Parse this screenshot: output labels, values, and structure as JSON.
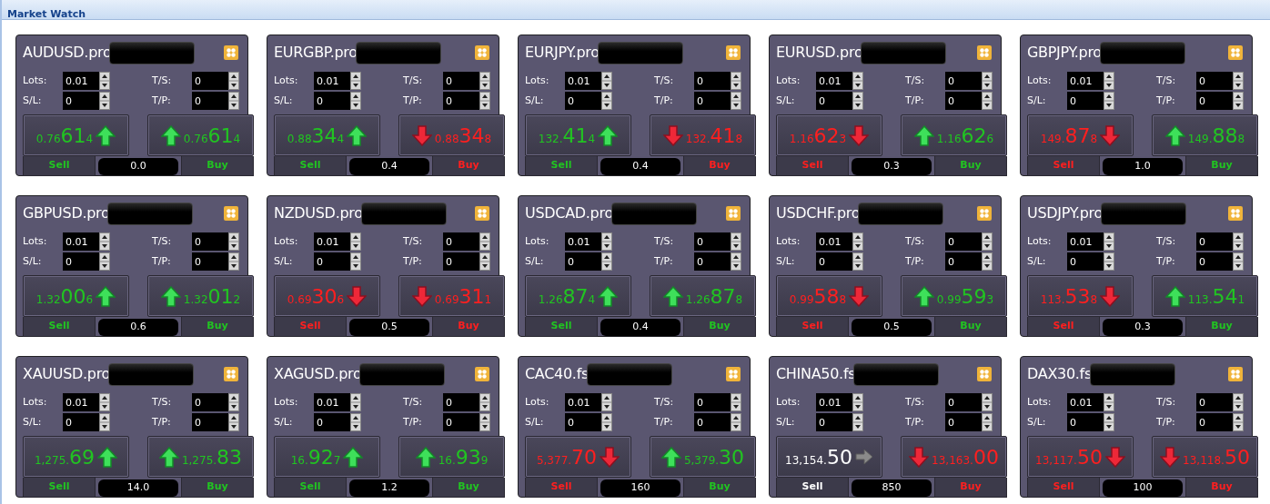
{
  "panel_title": "Market Watch",
  "cards": [
    {
      "symbol": "AUDUSD.pro",
      "labels": [
        "Lots:",
        "T/S:",
        "S/L:",
        "T/P:"
      ],
      "lots": "0.01",
      "sl": "0",
      "ts": "0",
      "tp": "0",
      "sell": {
        "prefix": "0.76",
        "big": "61",
        "pip": "4",
        "kind": "up",
        "label": "Sell"
      },
      "buy": {
        "prefix": "0.76",
        "big": "61",
        "pip": "4",
        "kind": "up",
        "label": "Buy"
      },
      "spread": "0.0"
    },
    {
      "symbol": "EURGBP.pro",
      "labels": [
        "Lots:",
        "T/S:",
        "S/L:",
        "T/P:"
      ],
      "lots": "0.01",
      "sl": "0",
      "ts": "0",
      "tp": "0",
      "sell": {
        "prefix": "0.88",
        "big": "34",
        "pip": "4",
        "kind": "up",
        "label": "Sell"
      },
      "buy": {
        "prefix": "0.88",
        "big": "34",
        "pip": "8",
        "kind": "down",
        "label": "Buy"
      },
      "spread": "0.4"
    },
    {
      "symbol": "EURJPY.pro",
      "labels": [
        "Lots:",
        "T/S:",
        "S/L:",
        "T/P:"
      ],
      "lots": "0.01",
      "sl": "0",
      "ts": "0",
      "tp": "0",
      "sell": {
        "prefix": "132.",
        "big": "41",
        "pip": "4",
        "kind": "up",
        "label": "Sell"
      },
      "buy": {
        "prefix": "132.",
        "big": "41",
        "pip": "8",
        "kind": "down",
        "label": "Buy"
      },
      "spread": "0.4"
    },
    {
      "symbol": "EURUSD.pro",
      "labels": [
        "Lots:",
        "T/S:",
        "S/L:",
        "T/P:"
      ],
      "lots": "0.01",
      "sl": "0",
      "ts": "0",
      "tp": "0",
      "sell": {
        "prefix": "1.16",
        "big": "62",
        "pip": "3",
        "kind": "down",
        "label": "Sell"
      },
      "buy": {
        "prefix": "1.16",
        "big": "62",
        "pip": "6",
        "kind": "up",
        "label": "Buy"
      },
      "spread": "0.3"
    },
    {
      "symbol": "GBPJPY.pro",
      "labels": [
        "Lots:",
        "T/S:",
        "S/L:",
        "T/P:"
      ],
      "lots": "0.01",
      "sl": "0",
      "ts": "0",
      "tp": "0",
      "sell": {
        "prefix": "149.",
        "big": "87",
        "pip": "8",
        "kind": "down",
        "label": "Sell"
      },
      "buy": {
        "prefix": "149.",
        "big": "88",
        "pip": "8",
        "kind": "up",
        "label": "Buy"
      },
      "spread": "1.0"
    },
    {
      "symbol": "GBPUSD.pro",
      "labels": [
        "Lots:",
        "T/S:",
        "S/L:",
        "T/P:"
      ],
      "lots": "0.01",
      "sl": "0",
      "ts": "0",
      "tp": "0",
      "sell": {
        "prefix": "1.32",
        "big": "00",
        "pip": "6",
        "kind": "up",
        "label": "Sell"
      },
      "buy": {
        "prefix": "1.32",
        "big": "01",
        "pip": "2",
        "kind": "up",
        "label": "Buy"
      },
      "spread": "0.6"
    },
    {
      "symbol": "NZDUSD.pro",
      "labels": [
        "Lots:",
        "T/S:",
        "S/L:",
        "T/P:"
      ],
      "lots": "0.01",
      "sl": "0",
      "ts": "0",
      "tp": "0",
      "sell": {
        "prefix": "0.69",
        "big": "30",
        "pip": "6",
        "kind": "down",
        "label": "Sell"
      },
      "buy": {
        "prefix": "0.69",
        "big": "31",
        "pip": "1",
        "kind": "down",
        "label": "Buy"
      },
      "spread": "0.5"
    },
    {
      "symbol": "USDCAD.pro",
      "labels": [
        "Lots:",
        "T/S:",
        "S/L:",
        "T/P:"
      ],
      "lots": "0.01",
      "sl": "0",
      "ts": "0",
      "tp": "0",
      "sell": {
        "prefix": "1.26",
        "big": "87",
        "pip": "4",
        "kind": "up",
        "label": "Sell"
      },
      "buy": {
        "prefix": "1.26",
        "big": "87",
        "pip": "8",
        "kind": "up",
        "label": "Buy"
      },
      "spread": "0.4"
    },
    {
      "symbol": "USDCHF.pro",
      "labels": [
        "Lots:",
        "T/S:",
        "S/L:",
        "T/P:"
      ],
      "lots": "0.01",
      "sl": "0",
      "ts": "0",
      "tp": "0",
      "sell": {
        "prefix": "0.99",
        "big": "58",
        "pip": "8",
        "kind": "down",
        "label": "Sell"
      },
      "buy": {
        "prefix": "0.99",
        "big": "59",
        "pip": "3",
        "kind": "up",
        "label": "Buy"
      },
      "spread": "0.5"
    },
    {
      "symbol": "USDJPY.pro",
      "labels": [
        "Lots:",
        "T/S:",
        "S/L:",
        "T/P:"
      ],
      "lots": "0.01",
      "sl": "0",
      "ts": "0",
      "tp": "0",
      "sell": {
        "prefix": "113.",
        "big": "53",
        "pip": "8",
        "kind": "down",
        "label": "Sell"
      },
      "buy": {
        "prefix": "113.",
        "big": "54",
        "pip": "1",
        "kind": "up",
        "label": "Buy"
      },
      "spread": "0.3"
    },
    {
      "symbol": "XAUUSD.pro",
      "labels": [
        "Lots:",
        "T/S:",
        "S/L:",
        "T/P:"
      ],
      "lots": "0.01",
      "sl": "0",
      "ts": "0",
      "tp": "0",
      "sell": {
        "prefix": "1,275.",
        "big": "69",
        "kind": "up",
        "label": "Sell"
      },
      "buy": {
        "prefix": "1,275.",
        "big": "83",
        "kind": "up",
        "label": "Buy"
      },
      "spread": "14.0"
    },
    {
      "symbol": "XAGUSD.pro",
      "labels": [
        "Lots:",
        "T/S:",
        "S/L:",
        "T/P:"
      ],
      "lots": "0.01",
      "sl": "0",
      "ts": "0",
      "tp": "0",
      "sell": {
        "prefix": "16.",
        "big": "92",
        "pip": "7",
        "kind": "up",
        "label": "Sell"
      },
      "buy": {
        "prefix": "16.",
        "big": "93",
        "pip": "9",
        "kind": "up",
        "label": "Buy"
      },
      "spread": "1.2"
    },
    {
      "symbol": "CAC40.fs",
      "labels": [
        "Lots:",
        "T/S:",
        "S/L:",
        "T/P:"
      ],
      "lots": "0.01",
      "sl": "0",
      "ts": "0",
      "tp": "0",
      "sell": {
        "prefix": "5,377.",
        "big": "70",
        "kind": "down",
        "label": "Sell"
      },
      "buy": {
        "prefix": "5,379.",
        "big": "30",
        "kind": "up",
        "label": "Buy"
      },
      "spread": "160"
    },
    {
      "symbol": "CHINA50.fs",
      "labels": [
        "Lots:",
        "T/S:",
        "S/L:",
        "T/P:"
      ],
      "lots": "0.01",
      "sl": "0",
      "ts": "0",
      "tp": "0",
      "sell": {
        "prefix": "13,154.",
        "big": "50",
        "kind": "flat",
        "label": "Sell"
      },
      "buy": {
        "prefix": "13,163.",
        "big": "00",
        "kind": "down",
        "label": "Buy"
      },
      "spread": "850"
    },
    {
      "symbol": "DAX30.fs",
      "labels": [
        "Lots:",
        "T/S:",
        "S/L:",
        "T/P:"
      ],
      "lots": "0.01",
      "sl": "0",
      "ts": "0",
      "tp": "0",
      "sell": {
        "prefix": "13,117.",
        "big": "50",
        "kind": "down",
        "label": "Sell"
      },
      "buy": {
        "prefix": "13,118.",
        "big": "50",
        "kind": "down",
        "label": "Buy"
      },
      "spread": "100"
    }
  ]
}
